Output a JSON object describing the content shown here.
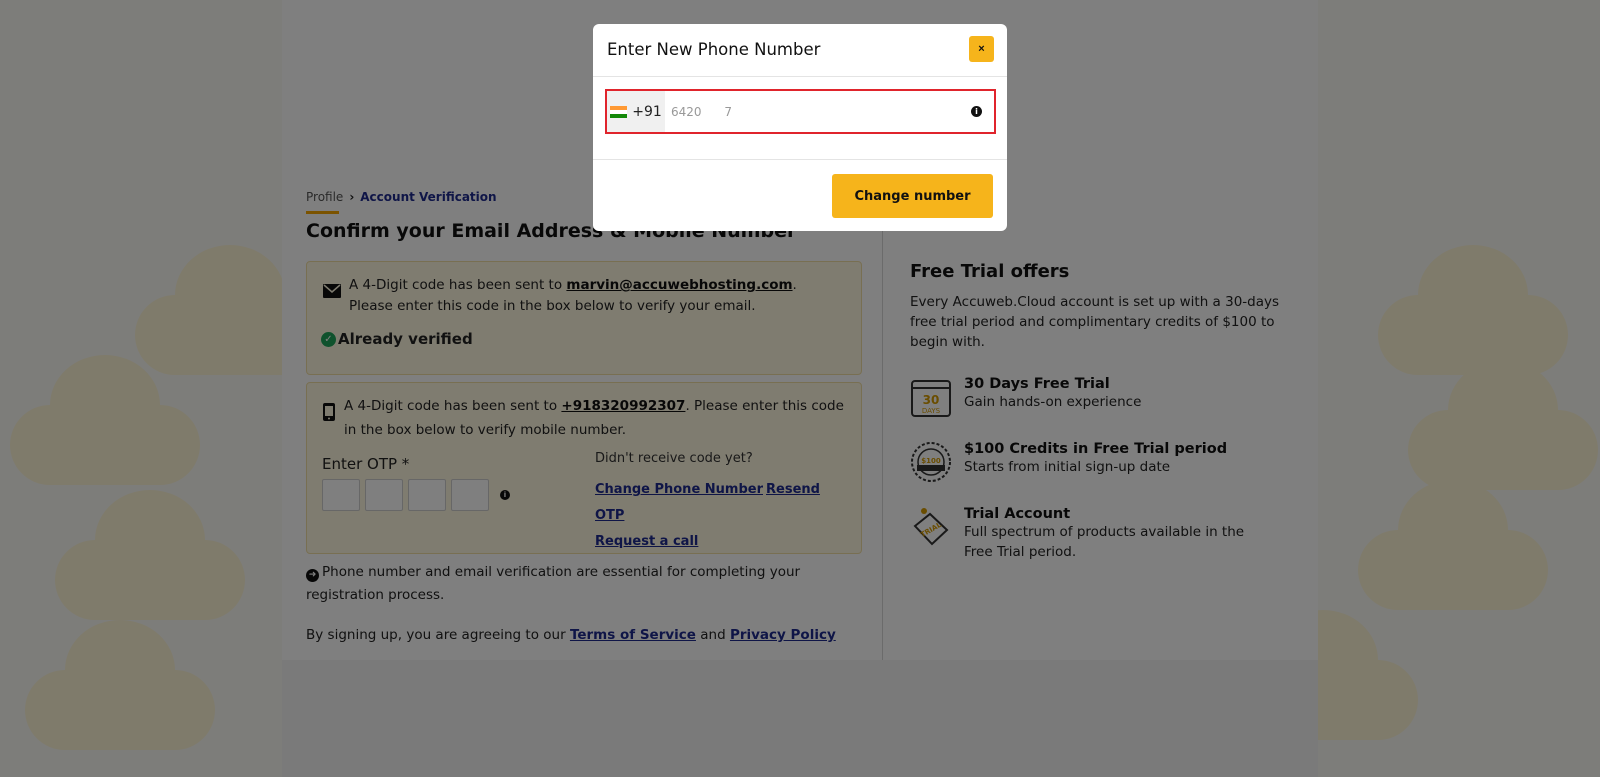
{
  "breadcrumb": {
    "profile": "Profile",
    "separator": "›",
    "current": "Account Verification"
  },
  "page_title": "Confirm your Email Address & Mobile Number",
  "email_card": {
    "text_before": "A 4-Digit code has been sent to ",
    "email": "marvin@accuwebhosting.com",
    "text_after": ". Please enter this code in the box below to verify your email.",
    "verified_label": "Already verified"
  },
  "mobile_card": {
    "text_before": "A 4-Digit code has been sent to ",
    "phone": "+918320992307",
    "text_after": ". Please enter this code in the box below to verify mobile number.",
    "otp_label": "Enter OTP *",
    "didnt_receive": "Didn't receive code yet?",
    "change_phone": "Change Phone Number",
    "resend_otp": "Resend OTP",
    "request_call": "Request a call"
  },
  "note": "Phone number and email verification are essential for completing your registration process.",
  "terms": {
    "prefix": "By signing up, you are agreeing to our ",
    "tos": "Terms of Service",
    "and": " and ",
    "privacy": "Privacy Policy"
  },
  "trial": {
    "title": "Free Trial offers",
    "description": "Every Accuweb.Cloud account is set up with a 30-days free trial period and complimentary credits of $100 to begin with.",
    "features": [
      {
        "title": "30 Days Free Trial",
        "subtitle": "Gain hands-on experience",
        "icon": "calendar-icon"
      },
      {
        "title": "$100 Credits in Free Trial period",
        "subtitle": "Starts from initial sign-up date",
        "icon": "badge-icon"
      },
      {
        "title": "Trial Account",
        "subtitle": "Full spectrum of products available in the Free Trial period.",
        "icon": "trial-tag-icon"
      }
    ]
  },
  "modal": {
    "title": "Enter New Phone Number",
    "close": "×",
    "country_code": "+91",
    "phone_value": "6420      7",
    "button": "Change number"
  },
  "colors": {
    "accent": "#f6b41b",
    "link": "#1e2b8f",
    "error_border": "#e0242c",
    "verified": "#1fa55a"
  }
}
